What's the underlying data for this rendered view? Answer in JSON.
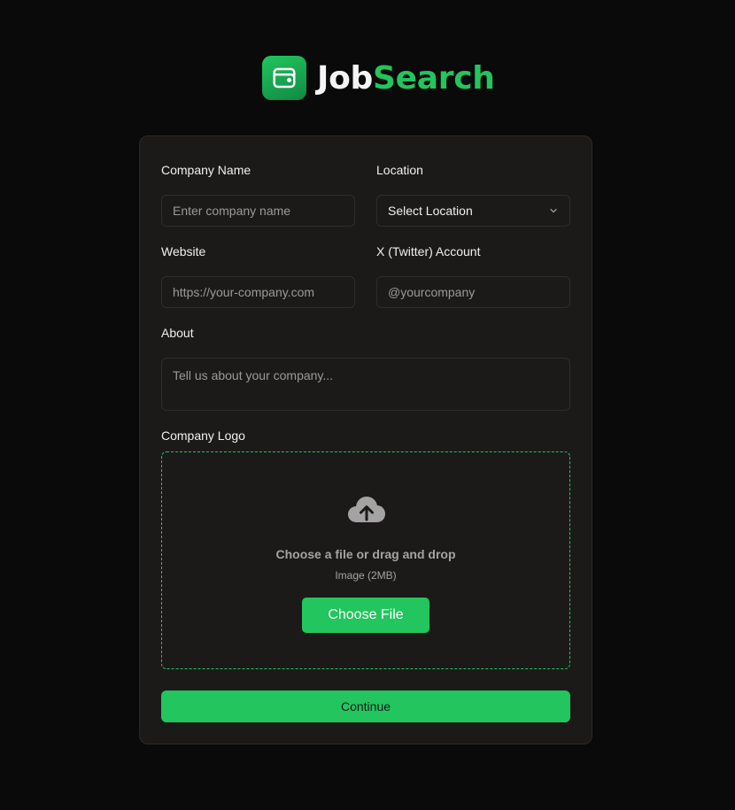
{
  "brand": {
    "part1": "Job",
    "part2": "Search",
    "icon": "wallet-icon"
  },
  "form": {
    "company_name": {
      "label": "Company Name",
      "placeholder": "Enter company name"
    },
    "location": {
      "label": "Location",
      "value": "Select Location",
      "icon": "chevron-down-icon"
    },
    "website": {
      "label": "Website",
      "placeholder": "https://your-company.com"
    },
    "twitter": {
      "label": "X (Twitter) Account",
      "placeholder": "@yourcompany"
    },
    "about": {
      "label": "About",
      "placeholder": "Tell us about your company..."
    },
    "logo": {
      "label": "Company Logo",
      "title": "Choose a file or drag and drop",
      "subtitle": "Image (2MB)",
      "button": "Choose File",
      "icon": "cloud-upload-icon"
    },
    "continue": "Continue"
  },
  "colors": {
    "accent": "#22c55e",
    "background": "#0a0a0a",
    "card": "#1c1a19"
  }
}
